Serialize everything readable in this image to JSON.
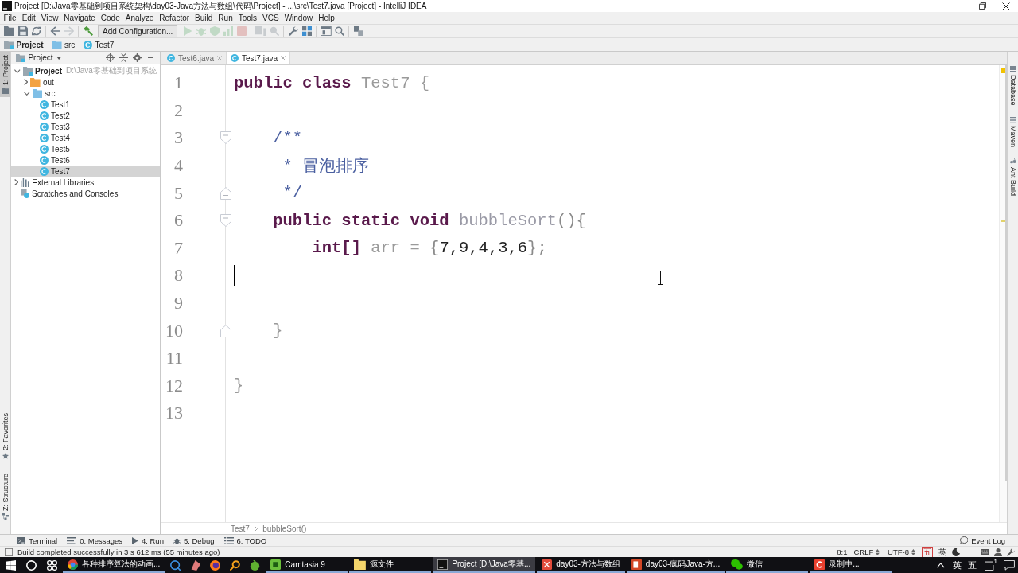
{
  "window": {
    "title": "Project [D:\\Java零基础到项目系统架构\\day03-Java方法与数组\\代码\\Project] - ...\\src\\Test7.java [Project] - IntelliJ IDEA"
  },
  "menu": [
    "File",
    "Edit",
    "View",
    "Navigate",
    "Code",
    "Analyze",
    "Refactor",
    "Build",
    "Run",
    "Tools",
    "VCS",
    "Window",
    "Help"
  ],
  "toolbar": [
    {
      "kind": "button",
      "disabled": false
    },
    {
      "kind": "button",
      "disabled": false
    },
    {
      "kind": "button",
      "disabled": false
    },
    {
      "kind": "separator"
    },
    {
      "kind": "button",
      "disabled": false
    },
    {
      "kind": "button",
      "disabled": true
    },
    {
      "kind": "separator"
    },
    {
      "kind": "button",
      "disabled": false
    },
    {
      "kind": "dropdown",
      "label": "Add Configuration..."
    },
    {
      "kind": "button",
      "disabled": true
    },
    {
      "kind": "button",
      "disabled": true
    },
    {
      "kind": "button",
      "disabled": true
    },
    {
      "kind": "button",
      "disabled": true
    },
    {
      "kind": "button",
      "disabled": true
    },
    {
      "kind": "separator"
    },
    {
      "kind": "button",
      "disabled": true
    },
    {
      "kind": "button",
      "disabled": true
    },
    {
      "kind": "separator"
    },
    {
      "kind": "button",
      "disabled": false
    },
    {
      "kind": "button",
      "disabled": false
    },
    {
      "kind": "separator"
    },
    {
      "kind": "button",
      "disabled": false
    },
    {
      "kind": "button",
      "disabled": false
    },
    {
      "kind": "separator"
    },
    {
      "kind": "button",
      "disabled": false
    }
  ],
  "navigation_bar": [
    {
      "kind": "project",
      "label": "Project"
    },
    {
      "kind": "folder",
      "label": "src"
    },
    {
      "kind": "class",
      "label": "Test7"
    }
  ],
  "left_tool_strip": {
    "top": [
      {
        "label": "1: Project",
        "selected": true
      }
    ],
    "bottom": [
      {
        "label": "2: Favorites",
        "selected": false
      },
      {
        "label": "Z: Structure",
        "selected": false
      }
    ]
  },
  "project_panel": {
    "view": "Project",
    "tree": [
      {
        "name": "Project",
        "kind": "project",
        "path": "D:\\Java零基础到项目系统",
        "expanded": true,
        "selected": false,
        "children": [
          {
            "name": "out",
            "kind": "excluded-folder",
            "expanded": false,
            "selected": false
          },
          {
            "name": "src",
            "kind": "source-folder",
            "expanded": true,
            "selected": false,
            "children": [
              {
                "name": "Test1",
                "kind": "class",
                "selected": false
              },
              {
                "name": "Test2",
                "kind": "class",
                "selected": false
              },
              {
                "name": "Test3",
                "kind": "class",
                "selected": false
              },
              {
                "name": "Test4",
                "kind": "class",
                "selected": false
              },
              {
                "name": "Test5",
                "kind": "class",
                "selected": false
              },
              {
                "name": "Test6",
                "kind": "class",
                "selected": false
              },
              {
                "name": "Test7",
                "kind": "class",
                "selected": true
              }
            ]
          }
        ]
      },
      {
        "name": "External Libraries",
        "kind": "libraries",
        "expanded": false,
        "selected": false
      },
      {
        "name": "Scratches and Consoles",
        "kind": "scratches",
        "selected": false
      }
    ]
  },
  "editor": {
    "tabs": [
      {
        "label": "Test6.java",
        "selected": false
      },
      {
        "label": "Test7.java",
        "selected": true
      }
    ],
    "lines": [
      {
        "number": "1",
        "kind": "plain",
        "caret": false,
        "warning": false,
        "tokens": [
          {
            "kind": "keyword",
            "text": "public class"
          },
          {
            "kind": "class",
            "text": " Test7"
          },
          {
            "kind": "brace",
            "text": " {"
          }
        ]
      },
      {
        "number": "2",
        "kind": "plain",
        "caret": false,
        "warning": false
      },
      {
        "number": "3",
        "kind": "fold-start",
        "caret": false,
        "warning": false,
        "tokens": [
          {
            "kind": "comment",
            "text": "    /**"
          }
        ]
      },
      {
        "number": "4",
        "kind": "plain",
        "caret": false,
        "warning": false,
        "tokens": [
          {
            "kind": "comment",
            "text": "     * 冒泡排序"
          }
        ]
      },
      {
        "number": "5",
        "kind": "fold-end",
        "caret": false,
        "warning": false,
        "tokens": [
          {
            "kind": "comment",
            "text": "     */"
          }
        ]
      },
      {
        "number": "6",
        "kind": "fold-start",
        "caret": false,
        "warning": true,
        "tokens": [
          {
            "kind": "keyword",
            "text": "    public static void"
          },
          {
            "kind": "method",
            "text": " bubbleSort"
          },
          {
            "kind": "punct",
            "text": "(){"
          }
        ]
      },
      {
        "number": "7",
        "kind": "plain",
        "caret": false,
        "warning": false,
        "tokens": [
          {
            "kind": "keyword",
            "text": "        int[]"
          },
          {
            "kind": "variable",
            "text": " arr"
          },
          {
            "kind": "operator",
            "text": " ="
          },
          {
            "kind": "punct",
            "text": " {"
          },
          {
            "kind": "number",
            "text": "7,9,4,3,6"
          },
          {
            "kind": "punct",
            "text": "};"
          }
        ]
      },
      {
        "number": "8",
        "kind": "plain",
        "caret": true,
        "warning": false
      },
      {
        "number": "9",
        "kind": "plain",
        "caret": false,
        "warning": false
      },
      {
        "number": "10",
        "kind": "fold-end",
        "caret": false,
        "warning": false,
        "tokens": [
          {
            "kind": "brace",
            "text": "    }"
          }
        ]
      },
      {
        "number": "11",
        "kind": "plain",
        "caret": false,
        "warning": false
      },
      {
        "number": "12",
        "kind": "plain",
        "caret": false,
        "warning": false,
        "tokens": [
          {
            "kind": "brace",
            "text": "}"
          }
        ]
      },
      {
        "number": "13",
        "kind": "plain",
        "caret": false,
        "warning": false
      }
    ],
    "breadcrumb": [
      "Test7",
      "bubbleSort()"
    ]
  },
  "right_tool_strip": [
    "Database",
    "Maven",
    "Ant Build"
  ],
  "tool_window_bar": {
    "items": [
      "Terminal",
      "0: Messages",
      "4: Run",
      "5: Debug",
      "6: TODO"
    ],
    "event_log": "Event Log"
  },
  "status_bar": {
    "message": "Build completed successfully in 3 s 612 ms (55 minutes ago)",
    "position": "8:1",
    "line_separator": "CRLF",
    "encoding": "UTF-8",
    "ime": [
      "五",
      "英"
    ]
  },
  "taskbar": {
    "apps": [
      {
        "kind": "window",
        "label": "各种排序算法的动画...",
        "selected": false
      },
      {
        "kind": "pinned",
        "selected": false
      },
      {
        "kind": "pinned",
        "selected": false
      },
      {
        "kind": "pinned",
        "selected": false
      },
      {
        "kind": "pinned",
        "selected": false
      },
      {
        "kind": "pinned",
        "selected": false
      },
      {
        "kind": "window",
        "label": "Camtasia 9",
        "selected": false
      },
      {
        "kind": "window",
        "label": "源文件",
        "selected": false
      },
      {
        "kind": "window",
        "label": "Project [D:\\Java零基...",
        "selected": true
      },
      {
        "kind": "window",
        "label": "day03-方法与数组",
        "selected": false
      },
      {
        "kind": "window",
        "label": "day03-疯码Java-方...",
        "selected": false
      },
      {
        "kind": "window",
        "label": "微信",
        "selected": false
      },
      {
        "kind": "window",
        "label": "录制中...",
        "selected": false
      }
    ],
    "tray": {
      "ime": [
        "英",
        "五"
      ],
      "notifications": "1"
    }
  }
}
